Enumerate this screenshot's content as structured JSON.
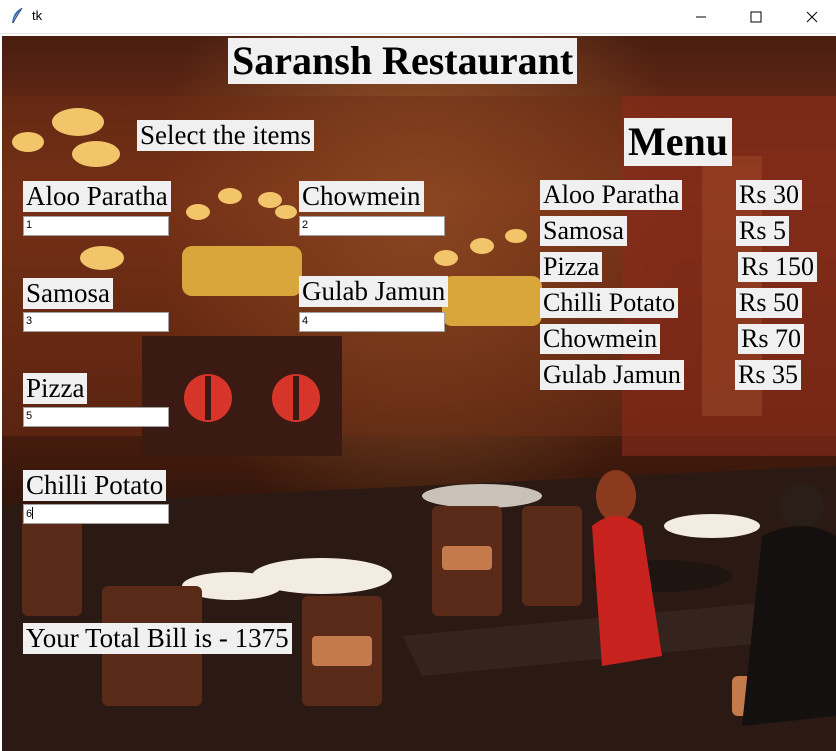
{
  "window": {
    "title": "tk",
    "controls": [
      "minimize",
      "maximize",
      "close"
    ]
  },
  "header": {
    "restaurant_name": "Saransh Restaurant",
    "select_prompt": "Select the items"
  },
  "order_items": [
    {
      "label": "Aloo Paratha",
      "quantity": "1"
    },
    {
      "label": "Samosa",
      "quantity": "3"
    },
    {
      "label": "Pizza",
      "quantity": "5"
    },
    {
      "label": "Chilli Potato",
      "quantity": "6"
    },
    {
      "label": "Chowmein",
      "quantity": "2"
    },
    {
      "label": "Gulab Jamun",
      "quantity": "4"
    }
  ],
  "menu": {
    "title": "Menu",
    "items": [
      {
        "name": "Aloo Paratha",
        "price": "Rs 30"
      },
      {
        "name": "Samosa",
        "price": "Rs 5"
      },
      {
        "name": "Pizza",
        "price": "Rs 150"
      },
      {
        "name": "Chilli Potato",
        "price": "Rs 50"
      },
      {
        "name": "Chowmein",
        "price": "Rs 70"
      },
      {
        "name": "Gulab Jamun",
        "price": "Rs 35"
      }
    ]
  },
  "bill": {
    "text": "Your Total Bill is - 1375"
  }
}
